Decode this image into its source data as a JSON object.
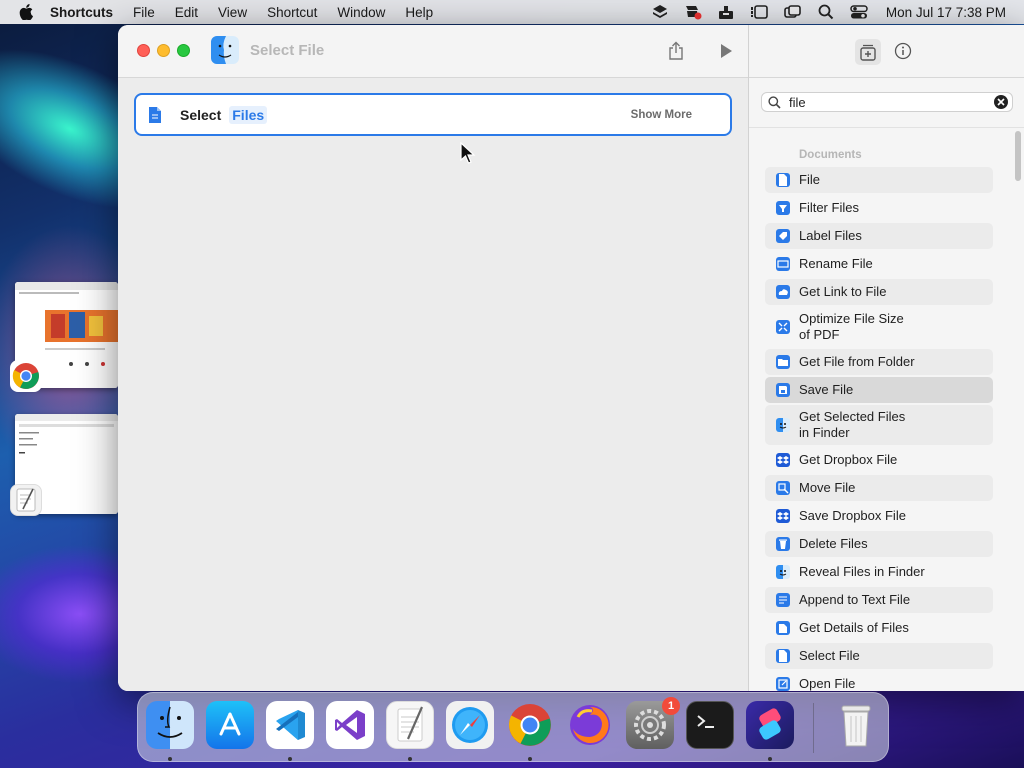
{
  "menubar": {
    "app_name": "Shortcuts",
    "menus": [
      "File",
      "Edit",
      "View",
      "Shortcut",
      "Window",
      "Help"
    ],
    "clock": "Mon Jul 17  7:38 PM"
  },
  "window": {
    "title": "Select File",
    "action": {
      "label": "Select",
      "parameter": "Files",
      "show_more": "Show More"
    }
  },
  "sidebar": {
    "search_query": "file",
    "section_title": "Documents",
    "items": [
      {
        "label": "File",
        "icon": "doc-icon",
        "color": "#2b7ae8"
      },
      {
        "label": "Filter Files",
        "icon": "filter-icon",
        "color": "#2b7ae8"
      },
      {
        "label": "Label Files",
        "icon": "tag-icon",
        "color": "#2b7ae8"
      },
      {
        "label": "Rename File",
        "icon": "rename-icon",
        "color": "#2b7ae8"
      },
      {
        "label": "Get Link to File",
        "icon": "cloud-icon",
        "color": "#2b7ae8"
      },
      {
        "label": "Optimize File Size of PDF",
        "icon": "compress-icon",
        "color": "#2b7ae8"
      },
      {
        "label": "Get File from Folder",
        "icon": "folder-icon",
        "color": "#2b7ae8"
      },
      {
        "label": "Save File",
        "icon": "save-icon",
        "color": "#2b7ae8"
      },
      {
        "label": "Get Selected Files in Finder",
        "icon": "finder-icon",
        "color": "#2b7ae8"
      },
      {
        "label": "Get Dropbox File",
        "icon": "dropbox-icon",
        "color": "#1e5ad6"
      },
      {
        "label": "Move File",
        "icon": "move-icon",
        "color": "#2b7ae8"
      },
      {
        "label": "Save Dropbox File",
        "icon": "dropbox-icon",
        "color": "#1e5ad6"
      },
      {
        "label": "Delete Files",
        "icon": "trash-icon",
        "color": "#2b7ae8"
      },
      {
        "label": "Reveal Files in Finder",
        "icon": "finder-icon",
        "color": "#2b7ae8"
      },
      {
        "label": "Append to Text File",
        "icon": "text-icon",
        "color": "#2b7ae8"
      },
      {
        "label": "Get Details of Files",
        "icon": "details-icon",
        "color": "#2b7ae8"
      },
      {
        "label": "Select File",
        "icon": "doc-icon",
        "color": "#2b7ae8"
      },
      {
        "label": "Open File",
        "icon": "open-icon",
        "color": "#2b7ae8"
      }
    ]
  },
  "dock": {
    "apps": [
      "Finder",
      "App Store",
      "Visual Studio Code",
      "Visual Studio",
      "TextEdit",
      "Safari",
      "Google Chrome",
      "Firefox",
      "System Settings",
      "Terminal",
      "Shortcuts",
      "Trash"
    ],
    "system_settings_badge": "1"
  },
  "colors": {
    "accent": "#2b7ae8",
    "close": "#ff5f57",
    "minimize": "#febc2e",
    "maximize": "#28c840"
  }
}
